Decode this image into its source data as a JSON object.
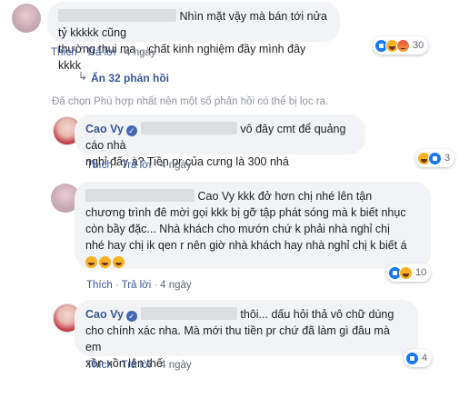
{
  "comments": [
    {
      "author": "",
      "text_line1": "Nhìn mặt vậy mà bán tới nửa tỷ kkkkk cũng",
      "text_line2": "thường thui ma ...chất kinh nghiệm đầy mình đây kkkk",
      "like": "Thích",
      "reply": "Trả lời",
      "time": "4 ngày",
      "reaction_count": "30"
    }
  ],
  "replies_toggle": {
    "label": "Ẩn 32 phản hồi",
    "note": "Đã chọn Phù hợp nhất nên một số phản hồi có thể bị lọc ra."
  },
  "reply1": {
    "author": "Cao Vy",
    "text_line1": "vô đây cmt để quảng cáo nhà",
    "text_line2": "nghỉ đấy à? Tiền pr của cưng là 300 nhá",
    "like": "Thích",
    "reply": "Trả lời",
    "time": "4 ngày",
    "reaction_count": "3"
  },
  "reply2": {
    "text_line1": "Cao Vy kkk đở hơn chị nhé lên tận",
    "text_line2": "chương trình đê mời gọi kkk bị gỡ tập phát sóng mà k biết nhục",
    "text_line3": "còn bầy đặc... Nhà khách cho mướn chứ k phải nhà nghỉ chị",
    "text_line4": "nhé hay chị ik qen r nên giờ nhà khách hay nhà nghỉ chị k biết á",
    "like": "Thích",
    "reply": "Trả lời",
    "time": "4 ngày",
    "reaction_count": "10"
  },
  "reply3": {
    "author": "Cao Vy",
    "text_line1": "thôi... dấu hỏi thả vô chữ dùng",
    "text_line2": "cho chính xác nha. Mà mới thu tiền pr chứ đã làm gì đâu mà em",
    "text_line3": "xồn xồn lên thế",
    "like": "Thích",
    "reply": "Trả lời",
    "time": "4 ngày",
    "reaction_count": "4"
  },
  "colors": {
    "link": "#385898",
    "bubble": "#f2f3f5",
    "meta": "#616770",
    "like_blue": "#1877f2"
  }
}
